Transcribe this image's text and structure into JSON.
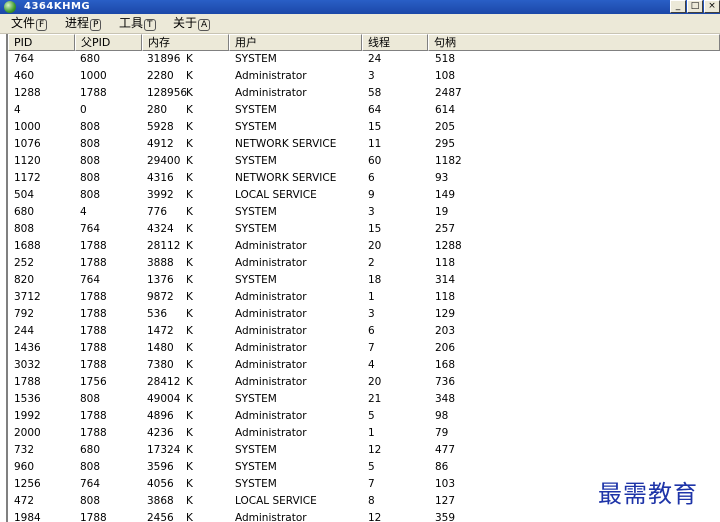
{
  "window": {
    "title": "4364KHMG",
    "controls": {
      "minimize": "_",
      "maximize": "□",
      "close": "×"
    }
  },
  "menubar": [
    {
      "label": "文件",
      "accel": "F"
    },
    {
      "label": "进程",
      "accel": "P"
    },
    {
      "label": "工具",
      "accel": "T"
    },
    {
      "label": "关于",
      "accel": "A"
    }
  ],
  "table": {
    "columns": [
      "PID",
      "父PID",
      "内存",
      "用户",
      "线程",
      "句柄"
    ],
    "unit": "K",
    "rows": [
      {
        "pid": "764",
        "ppid": "680",
        "mem": "31896",
        "user": "SYSTEM",
        "threads": "24",
        "handles": "518"
      },
      {
        "pid": "460",
        "ppid": "1000",
        "mem": "2280",
        "user": "Administrator",
        "threads": "3",
        "handles": "108"
      },
      {
        "pid": "1288",
        "ppid": "1788",
        "mem": "128956",
        "user": "Administrator",
        "threads": "58",
        "handles": "2487"
      },
      {
        "pid": "4",
        "ppid": "0",
        "mem": "280",
        "user": "SYSTEM",
        "threads": "64",
        "handles": "614"
      },
      {
        "pid": "1000",
        "ppid": "808",
        "mem": "5928",
        "user": "SYSTEM",
        "threads": "15",
        "handles": "205"
      },
      {
        "pid": "1076",
        "ppid": "808",
        "mem": "4912",
        "user": "NETWORK SERVICE",
        "threads": "11",
        "handles": "295"
      },
      {
        "pid": "1120",
        "ppid": "808",
        "mem": "29400",
        "user": "SYSTEM",
        "threads": "60",
        "handles": "1182"
      },
      {
        "pid": "1172",
        "ppid": "808",
        "mem": "4316",
        "user": "NETWORK SERVICE",
        "threads": "6",
        "handles": "93"
      },
      {
        "pid": "504",
        "ppid": "808",
        "mem": "3992",
        "user": "LOCAL SERVICE",
        "threads": "9",
        "handles": "149"
      },
      {
        "pid": "680",
        "ppid": "4",
        "mem": "776",
        "user": "SYSTEM",
        "threads": "3",
        "handles": "19"
      },
      {
        "pid": "808",
        "ppid": "764",
        "mem": "4324",
        "user": "SYSTEM",
        "threads": "15",
        "handles": "257"
      },
      {
        "pid": "1688",
        "ppid": "1788",
        "mem": "28112",
        "user": "Administrator",
        "threads": "20",
        "handles": "1288"
      },
      {
        "pid": "252",
        "ppid": "1788",
        "mem": "3888",
        "user": "Administrator",
        "threads": "2",
        "handles": "118"
      },
      {
        "pid": "820",
        "ppid": "764",
        "mem": "1376",
        "user": "SYSTEM",
        "threads": "18",
        "handles": "314"
      },
      {
        "pid": "3712",
        "ppid": "1788",
        "mem": "9872",
        "user": "Administrator",
        "threads": "1",
        "handles": "118"
      },
      {
        "pid": "792",
        "ppid": "1788",
        "mem": "536",
        "user": "Administrator",
        "threads": "3",
        "handles": "129"
      },
      {
        "pid": "244",
        "ppid": "1788",
        "mem": "1472",
        "user": "Administrator",
        "threads": "6",
        "handles": "203"
      },
      {
        "pid": "1436",
        "ppid": "1788",
        "mem": "1480",
        "user": "Administrator",
        "threads": "7",
        "handles": "206"
      },
      {
        "pid": "3032",
        "ppid": "1788",
        "mem": "7380",
        "user": "Administrator",
        "threads": "4",
        "handles": "168"
      },
      {
        "pid": "1788",
        "ppid": "1756",
        "mem": "28412",
        "user": "Administrator",
        "threads": "20",
        "handles": "736"
      },
      {
        "pid": "1536",
        "ppid": "808",
        "mem": "49004",
        "user": "SYSTEM",
        "threads": "21",
        "handles": "348"
      },
      {
        "pid": "1992",
        "ppid": "1788",
        "mem": "4896",
        "user": "Administrator",
        "threads": "5",
        "handles": "98"
      },
      {
        "pid": "2000",
        "ppid": "1788",
        "mem": "4236",
        "user": "Administrator",
        "threads": "1",
        "handles": "79"
      },
      {
        "pid": "732",
        "ppid": "680",
        "mem": "17324",
        "user": "SYSTEM",
        "threads": "12",
        "handles": "477"
      },
      {
        "pid": "960",
        "ppid": "808",
        "mem": "3596",
        "user": "SYSTEM",
        "threads": "5",
        "handles": "86"
      },
      {
        "pid": "1256",
        "ppid": "764",
        "mem": "4056",
        "user": "SYSTEM",
        "threads": "7",
        "handles": "103"
      },
      {
        "pid": "472",
        "ppid": "808",
        "mem": "3868",
        "user": "LOCAL SERVICE",
        "threads": "8",
        "handles": "127"
      },
      {
        "pid": "1984",
        "ppid": "1788",
        "mem": "2456",
        "user": "Administrator",
        "threads": "12",
        "handles": "359"
      }
    ]
  },
  "watermark": "最需教育"
}
